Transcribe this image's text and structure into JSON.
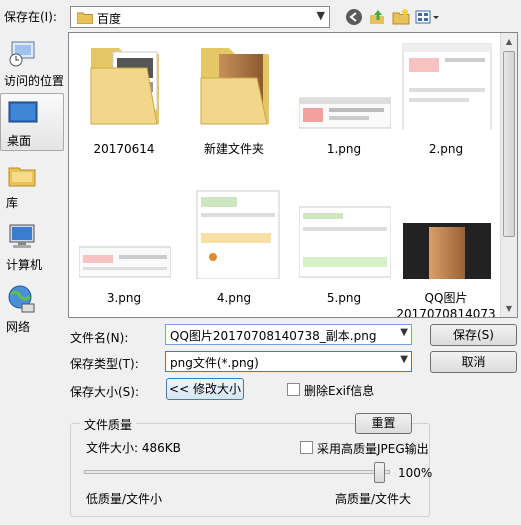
{
  "toolbar": {
    "save_in_label": "保存在(I):",
    "location": "百度"
  },
  "places": [
    {
      "label": "访问的位置",
      "icon": "recent-places-icon"
    },
    {
      "label": "桌面",
      "icon": "desktop-icon"
    },
    {
      "label": "库",
      "icon": "library-icon"
    },
    {
      "label": "计算机",
      "icon": "computer-icon"
    },
    {
      "label": "网络",
      "icon": "network-icon"
    }
  ],
  "files": [
    {
      "name": "20170614",
      "type": "folder"
    },
    {
      "name": "新建文件夹",
      "type": "folder"
    },
    {
      "name": "1.png",
      "type": "image"
    },
    {
      "name": "2.png",
      "type": "image"
    },
    {
      "name": "3.png",
      "type": "image"
    },
    {
      "name": "4.png",
      "type": "image"
    },
    {
      "name": "5.png",
      "type": "image"
    },
    {
      "name": "QQ图片\n2017070814073",
      "type": "image"
    }
  ],
  "form": {
    "filename_label": "文件名(N):",
    "filename_value": "QQ图片20170708140738_副本.png",
    "filetype_label": "保存类型(T):",
    "filetype_value": "png文件(*.png)",
    "filesize_label": "保存大小(S):",
    "resize_button": "<< 修改大小",
    "save_button": "保存(S)",
    "cancel_button": "取消",
    "delete_exif_label": "删除Exif信息"
  },
  "quality": {
    "group_title": "文件质量",
    "reset_button": "重置",
    "file_size_text": "文件大小: 486KB",
    "hq_jpeg_label": "采用高质量JPEG输出",
    "percent_text": "100%",
    "level": 1.0,
    "low_label": "低质量/文件小",
    "high_label": "高质量/文件大"
  }
}
